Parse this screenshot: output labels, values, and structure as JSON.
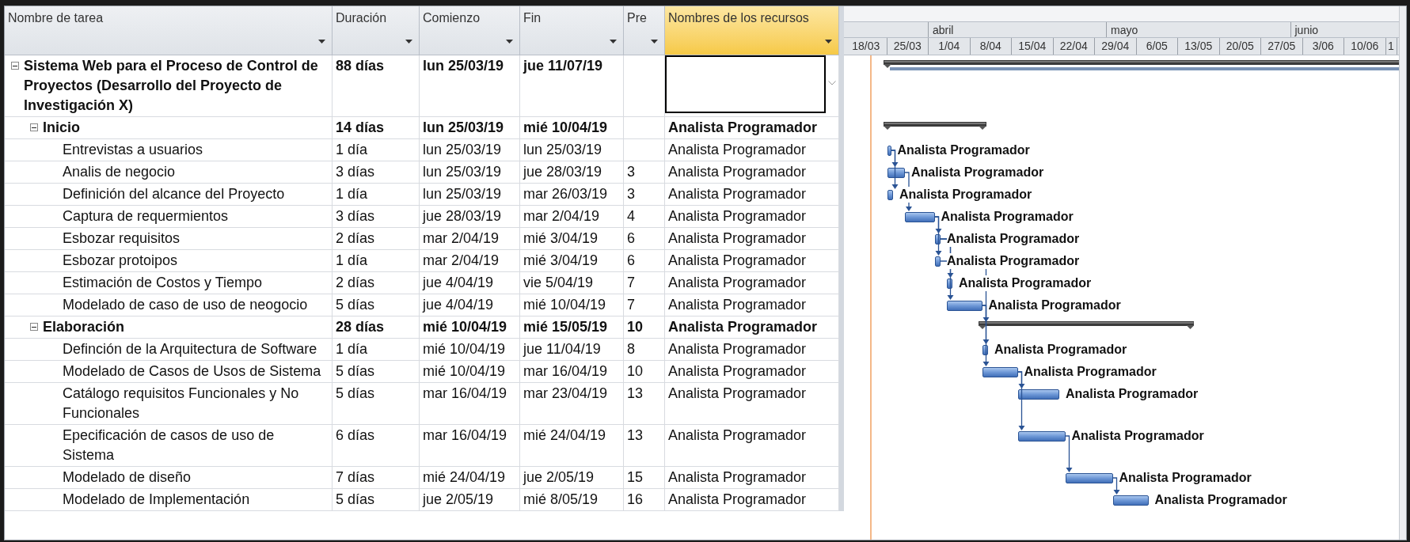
{
  "columns": [
    {
      "label": "Nombre de tarea",
      "selected": false
    },
    {
      "label": "Duración",
      "selected": false
    },
    {
      "label": "Comienzo",
      "selected": false
    },
    {
      "label": "Fin",
      "selected": false
    },
    {
      "label": "Pre",
      "selected": false
    },
    {
      "label": "Nombres de los recursos",
      "selected": true
    }
  ],
  "timescale": {
    "months": [
      "abril",
      "mayo",
      "junio"
    ],
    "weeks": [
      "18/03",
      "25/03",
      "1/04",
      "8/04",
      "15/04",
      "22/04",
      "29/04",
      "6/05",
      "13/05",
      "20/05",
      "27/05",
      "3/06",
      "10/06",
      "1"
    ]
  },
  "tasks": [
    {
      "name": "Sistema Web para el Proceso de Control de Proyectos (Desarrollo del Proyecto de Investigación X)",
      "duration": "88 días",
      "start": "lun 25/03/19",
      "finish": "jue 11/07/19",
      "selected": true,
      "expanded": true,
      "children": [
        {
          "name": "Inicio",
          "duration": "14 días",
          "start": "lun 25/03/19",
          "finish": "mié 10/04/19",
          "resources": "Analista Programador",
          "selected": false,
          "expanded": true,
          "children": [
            {
              "name": "Entrevistas a usuarios",
              "duration": "1 día",
              "start": "lun 25/03/19",
              "finish": "lun 25/03/19",
              "resources": "Analista Programador",
              "bar_label": "Analista Programador",
              "selected": false
            },
            {
              "name": "Analis de negocio",
              "duration": "3 días",
              "start": "lun 25/03/19",
              "finish": "jue 28/03/19",
              "predecessors": "3",
              "resources": "Analista Programador",
              "bar_label": "Analista Programador",
              "selected": false
            },
            {
              "name": "Definición del alcance del Proyecto",
              "duration": "1 día",
              "start": "lun 25/03/19",
              "finish": "mar 26/03/19",
              "predecessors": "3",
              "resources": "Analista Programador",
              "bar_label": "Analista Programador",
              "selected": false
            },
            {
              "name": "Captura de requermientos",
              "duration": "3 días",
              "start": "jue 28/03/19",
              "finish": "mar 2/04/19",
              "predecessors": "4",
              "resources": "Analista Programador",
              "bar_label": "Analista Programador",
              "selected": false
            },
            {
              "name": "Esbozar requisitos",
              "duration": "2 días",
              "start": "mar 2/04/19",
              "finish": "mié 3/04/19",
              "predecessors": "6",
              "resources": "Analista Programador",
              "bar_label": "Analista Programador",
              "selected": false
            },
            {
              "name": "Esbozar protoipos",
              "duration": "1 día",
              "start": "mar 2/04/19",
              "finish": "mié 3/04/19",
              "predecessors": "6",
              "resources": "Analista Programador",
              "bar_label": "Analista Programador",
              "selected": false
            },
            {
              "name": "Estimación de Costos y Tiempo",
              "duration": "2 días",
              "start": "jue 4/04/19",
              "finish": "vie 5/04/19",
              "predecessors": "7",
              "resources": "Analista Programador",
              "bar_label": "Analista Programador",
              "selected": false
            },
            {
              "name": "Modelado de caso de uso de neogocio",
              "duration": "5 días",
              "start": "jue 4/04/19",
              "finish": "mié 10/04/19",
              "predecessors": "7",
              "resources": "Analista Programador",
              "bar_label": "Analista Programador",
              "selected": false
            }
          ]
        },
        {
          "name": "Elaboración",
          "duration": "28 días",
          "start": "mié 10/04/19",
          "finish": "mié 15/05/19",
          "predecessors": "10",
          "resources": "Analista Programador",
          "selected": false,
          "expanded": true,
          "children": [
            {
              "name": "Definción de la Arquitectura de Software",
              "duration": "1 día",
              "start": "mié 10/04/19",
              "finish": "jue 11/04/19",
              "predecessors": "8",
              "resources": "Analista Programador",
              "bar_label": "Analista Programador",
              "selected": false
            },
            {
              "name": "Modelado de Casos de Usos de Sistema",
              "duration": "5 días",
              "start": "mié 10/04/19",
              "finish": "mar 16/04/19",
              "predecessors": "10",
              "resources": "Analista Programador",
              "bar_label": "Analista Programador",
              "selected": false
            },
            {
              "name": "Catálogo requisitos Funcionales y No Funcionales",
              "duration": "5 días",
              "start": "mar 16/04/19",
              "finish": "mar 23/04/19",
              "predecessors": "13",
              "resources": "Analista Programador",
              "bar_label": "Analista Programador",
              "selected": false
            },
            {
              "name": "Epecificación de casos de uso de Sistema",
              "duration": "6 días",
              "start": "mar 16/04/19",
              "finish": "mié 24/04/19",
              "predecessors": "13",
              "resources": "Analista Programador",
              "bar_label": "Analista Programador",
              "selected": false
            },
            {
              "name": "Modelado de diseño",
              "duration": "7 días",
              "start": "mié 24/04/19",
              "finish": "jue 2/05/19",
              "predecessors": "15",
              "resources": "Analista Programador",
              "bar_label": "Analista Programador",
              "selected": false
            },
            {
              "name": "Modelado de Implementación",
              "duration": "5 días",
              "start": "jue 2/05/19",
              "finish": "mié 8/05/19",
              "predecessors": "16",
              "resources": "Analista Programador",
              "bar_label": "Analista Programador",
              "selected": false
            }
          ]
        }
      ]
    }
  ]
}
